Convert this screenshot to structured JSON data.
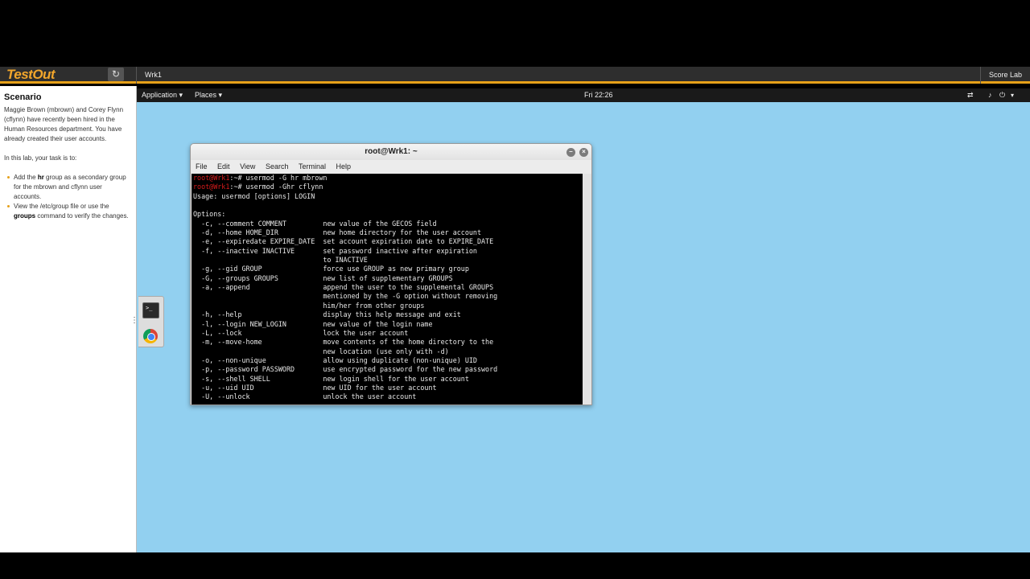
{
  "header": {
    "logo": "TestOut",
    "tab": "Wrk1",
    "score_button": "Score Lab",
    "refresh_icon": "↻"
  },
  "scenario": {
    "title": "Scenario",
    "intro": "Maggie Brown (mbrown) and Corey Flynn (cflynn) have recently been hired in the Human Resources department. You have already created their user accounts.",
    "task_intro": "In this lab, your task is to:",
    "task1_pre": "Add the ",
    "task1_bold": "hr",
    "task1_post": " group as a secondary group for the mbrown and cflynn user accounts.",
    "task2_pre": "View the /etc/group file or use the ",
    "task2_bold": "groups",
    "task2_post": " command to verify the changes."
  },
  "gnome": {
    "application_menu": "Application ▾",
    "places_menu": "Places ▾",
    "clock": "Fri 22:26",
    "tray_icons": [
      "network-icon",
      "volume-icon",
      "power-icon"
    ]
  },
  "terminal": {
    "title": "root@Wrk1: ~",
    "menu": [
      "File",
      "Edit",
      "View",
      "Search",
      "Terminal",
      "Help"
    ],
    "prompt": "root@Wrk1:~#",
    "lines": [
      {
        "prompt": "root@Wrk1",
        "text": ":~# usermod -G hr mbrown"
      },
      {
        "prompt": "root@Wrk1",
        "text": ":~# usermod -Ghr cflynn"
      },
      {
        "prompt": "",
        "text": "Usage: usermod [options] LOGIN"
      },
      {
        "prompt": "",
        "text": ""
      },
      {
        "prompt": "",
        "text": "Options:"
      },
      {
        "prompt": "",
        "text": "  -c, --comment COMMENT         new value of the GECOS field"
      },
      {
        "prompt": "",
        "text": "  -d, --home HOME_DIR           new home directory for the user account"
      },
      {
        "prompt": "",
        "text": "  -e, --expiredate EXPIRE_DATE  set account expiration date to EXPIRE_DATE"
      },
      {
        "prompt": "",
        "text": "  -f, --inactive INACTIVE       set password inactive after expiration"
      },
      {
        "prompt": "",
        "text": "                                to INACTIVE"
      },
      {
        "prompt": "",
        "text": "  -g, --gid GROUP               force use GROUP as new primary group"
      },
      {
        "prompt": "",
        "text": "  -G, --groups GROUPS           new list of supplementary GROUPS"
      },
      {
        "prompt": "",
        "text": "  -a, --append                  append the user to the supplemental GROUPS"
      },
      {
        "prompt": "",
        "text": "                                mentioned by the -G option without removing"
      },
      {
        "prompt": "",
        "text": "                                him/her from other groups"
      },
      {
        "prompt": "",
        "text": "  -h, --help                    display this help message and exit"
      },
      {
        "prompt": "",
        "text": "  -l, --login NEW_LOGIN         new value of the login name"
      },
      {
        "prompt": "",
        "text": "  -L, --lock                    lock the user account"
      },
      {
        "prompt": "",
        "text": "  -m, --move-home               move contents of the home directory to the"
      },
      {
        "prompt": "",
        "text": "                                new location (use only with -d)"
      },
      {
        "prompt": "",
        "text": "  -o, --non-unique              allow using duplicate (non-unique) UID"
      },
      {
        "prompt": "",
        "text": "  -p, --password PASSWORD       use encrypted password for the new password"
      },
      {
        "prompt": "",
        "text": "  -s, --shell SHELL             new login shell for the user account"
      },
      {
        "prompt": "",
        "text": "  -u, --uid UID                 new UID for the user account"
      },
      {
        "prompt": "",
        "text": "  -U, --unlock                  unlock the user account"
      }
    ]
  }
}
